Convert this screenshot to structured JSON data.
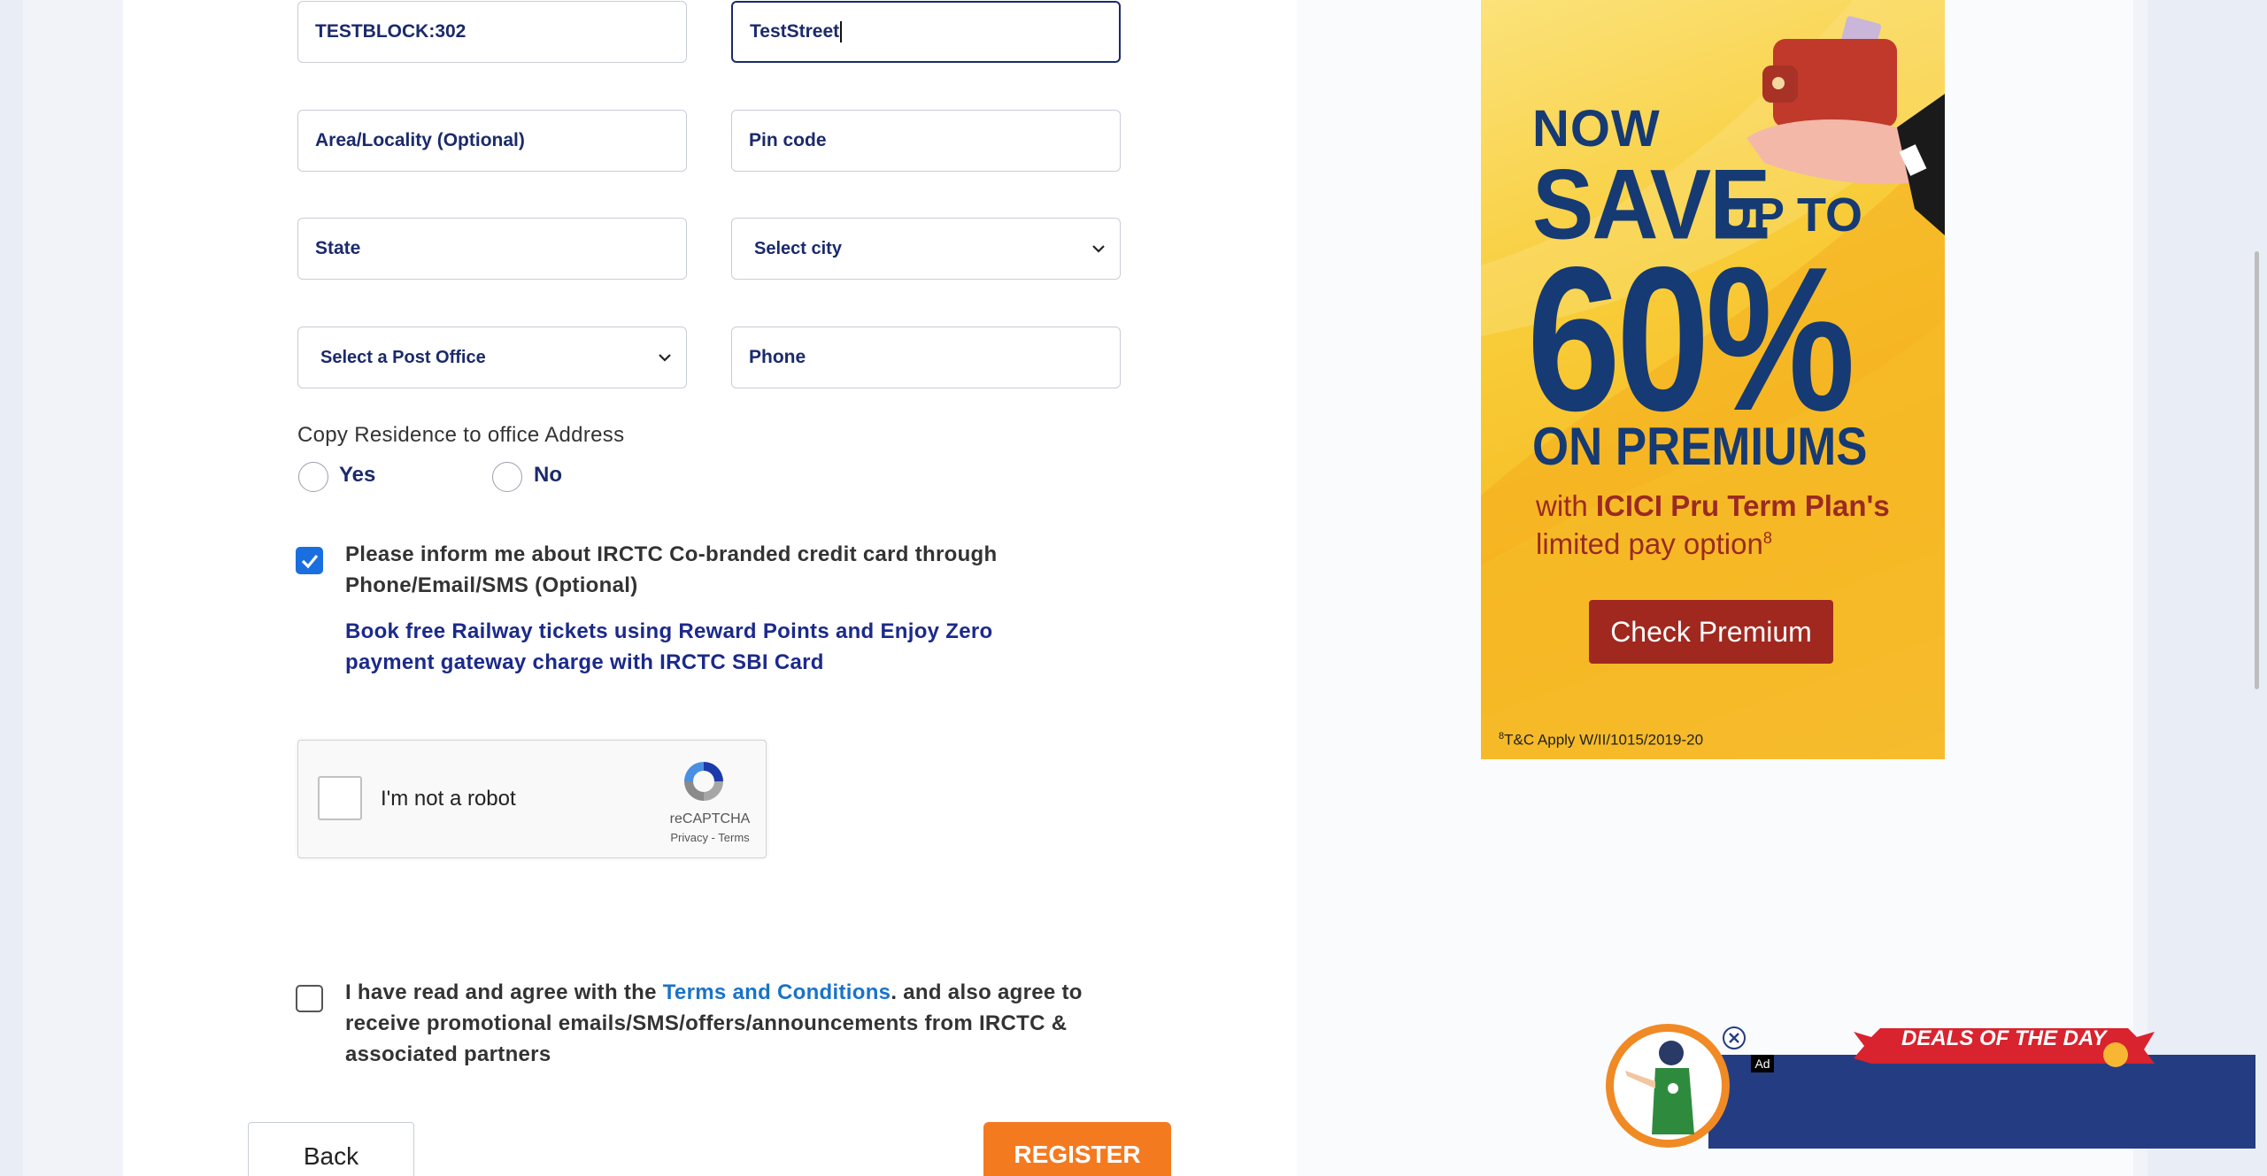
{
  "address": {
    "street_block": "TESTBLOCK:302",
    "street_name": "TestStreet",
    "area_placeholder": "Area/Locality (Optional)",
    "pincode_placeholder": "Pin code",
    "state_placeholder": "State",
    "city_select": "Select city",
    "post_office_select": "Select a Post Office",
    "phone_placeholder": "Phone"
  },
  "copy_residence": {
    "label": "Copy Residence to office Address",
    "yes": "Yes",
    "no": "No"
  },
  "credit_card_optin": {
    "checked": true,
    "text": "Please inform me about IRCTC Co-branded credit card through Phone/Email/SMS (Optional)",
    "promo": "Book free Railway tickets using Reward Points and Enjoy Zero payment gateway charge with IRCTC SBI Card"
  },
  "captcha": {
    "label": "I'm not a robot",
    "brand": "reCAPTCHA",
    "links": "Privacy - Terms"
  },
  "terms": {
    "checked": false,
    "prefix": "I have read and agree with the ",
    "link": "Terms and Conditions",
    "suffix": ". and also agree to receive promotional emails/SMS/offers/announcements from IRCTC & associated partners"
  },
  "buttons": {
    "back": "Back",
    "register": "REGISTER"
  },
  "ad_banner": {
    "now": "NOW",
    "save": "SAVE",
    "up_to": "UP TO",
    "percent": "60%",
    "premiums": "ON PREMIUMS",
    "with_prefix": "with ",
    "brand": "ICICI Pru Term Plan's",
    "limited": "limited pay option",
    "footnote_mark": "8",
    "cta": "Check Premium",
    "tc": "T&C Apply W/II/1015/2019-20",
    "colors": {
      "navy": "#163a73",
      "maroon": "#a0281f",
      "yellow": "#f8cd3a"
    }
  },
  "deals_ad": {
    "title": "DEALS OF THE DAY",
    "tag": "Ad"
  }
}
